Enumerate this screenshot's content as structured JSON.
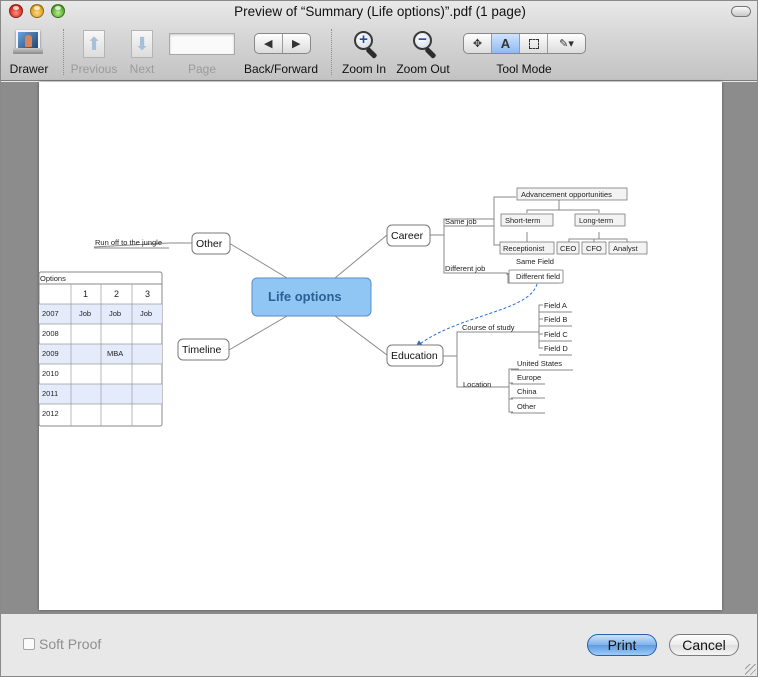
{
  "window": {
    "title": "Preview of “Summary (Life options)”.pdf (1 page)"
  },
  "toolbar": {
    "drawer": "Drawer",
    "previous": "Previous",
    "next": "Next",
    "page": "Page",
    "back_forward": "Back/Forward",
    "zoom_in": "Zoom In",
    "zoom_out": "Zoom Out",
    "tool_mode": "Tool Mode",
    "tool_mode_selected": "text-select"
  },
  "mindmap": {
    "center": "Life options",
    "other": {
      "label": "Other",
      "child": "Run off to the jungle"
    },
    "career": {
      "label": "Career",
      "same_job": "Same job",
      "different_job": "Different job",
      "advancement": "Advancement opportunities",
      "short_term": "Short-term",
      "long_term": "Long-term",
      "receptionist": "Receptionist",
      "ceo": "CEO",
      "cfo": "CFO",
      "analyst": "Analyst",
      "same_field": "Same Field",
      "different_field": "Different field"
    },
    "education": {
      "label": "Education",
      "course_of_study": "Course of study",
      "fields": [
        "Field A",
        "Field B",
        "Field C",
        "Field D"
      ],
      "location": "Location",
      "locations": [
        "United States",
        "Europe",
        "China",
        "Other"
      ]
    },
    "timeline": {
      "label": "Timeline",
      "table_title": "Options",
      "columns": [
        "",
        "1",
        "2",
        "3"
      ],
      "rows": [
        [
          "2007",
          "Job",
          "Job",
          "Job"
        ],
        [
          "2008",
          "",
          "",
          ""
        ],
        [
          "2009",
          "",
          "MBA",
          ""
        ],
        [
          "2010",
          "",
          "",
          ""
        ],
        [
          "2011",
          "",
          "",
          ""
        ],
        [
          "2012",
          "",
          "",
          ""
        ]
      ]
    }
  },
  "footer": {
    "soft_proof": "Soft Proof",
    "print": "Print",
    "cancel": "Cancel"
  },
  "colors": {
    "center_fill": "#8fc6f4",
    "center_stroke": "#5a8fc4",
    "row_highlight": "#e4ecfb",
    "link_dashed": "#2a6fd6"
  }
}
